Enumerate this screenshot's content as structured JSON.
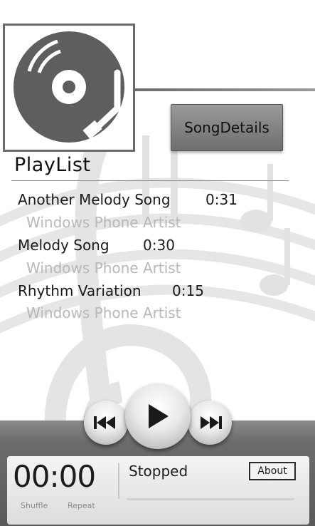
{
  "header": {
    "song_details_label": "SongDetails",
    "playlist_title": "PlayList"
  },
  "playlist": [
    {
      "title": "Another Melody Song",
      "duration": "0:31",
      "artist": "Windows Phone Artist"
    },
    {
      "title": "Melody Song",
      "duration": "0:30",
      "artist": "Windows Phone Artist"
    },
    {
      "title": "Rhythm Variation",
      "duration": "0:15",
      "artist": "Windows Phone Artist"
    }
  ],
  "player": {
    "time": "00:00",
    "status": "Stopped",
    "shuffle_label": "Shuffle",
    "repeat_label": "Repeat",
    "about_label": "About",
    "progress": 0
  },
  "icons": {
    "album_art": "vinyl-record-icon",
    "previous": "previous-track-icon",
    "play": "play-icon",
    "next": "next-track-icon"
  },
  "colors": {
    "accent_gray": "#6e6e6e",
    "artist_text": "#b8b8b8",
    "player_bar": "#6c6c6c"
  }
}
